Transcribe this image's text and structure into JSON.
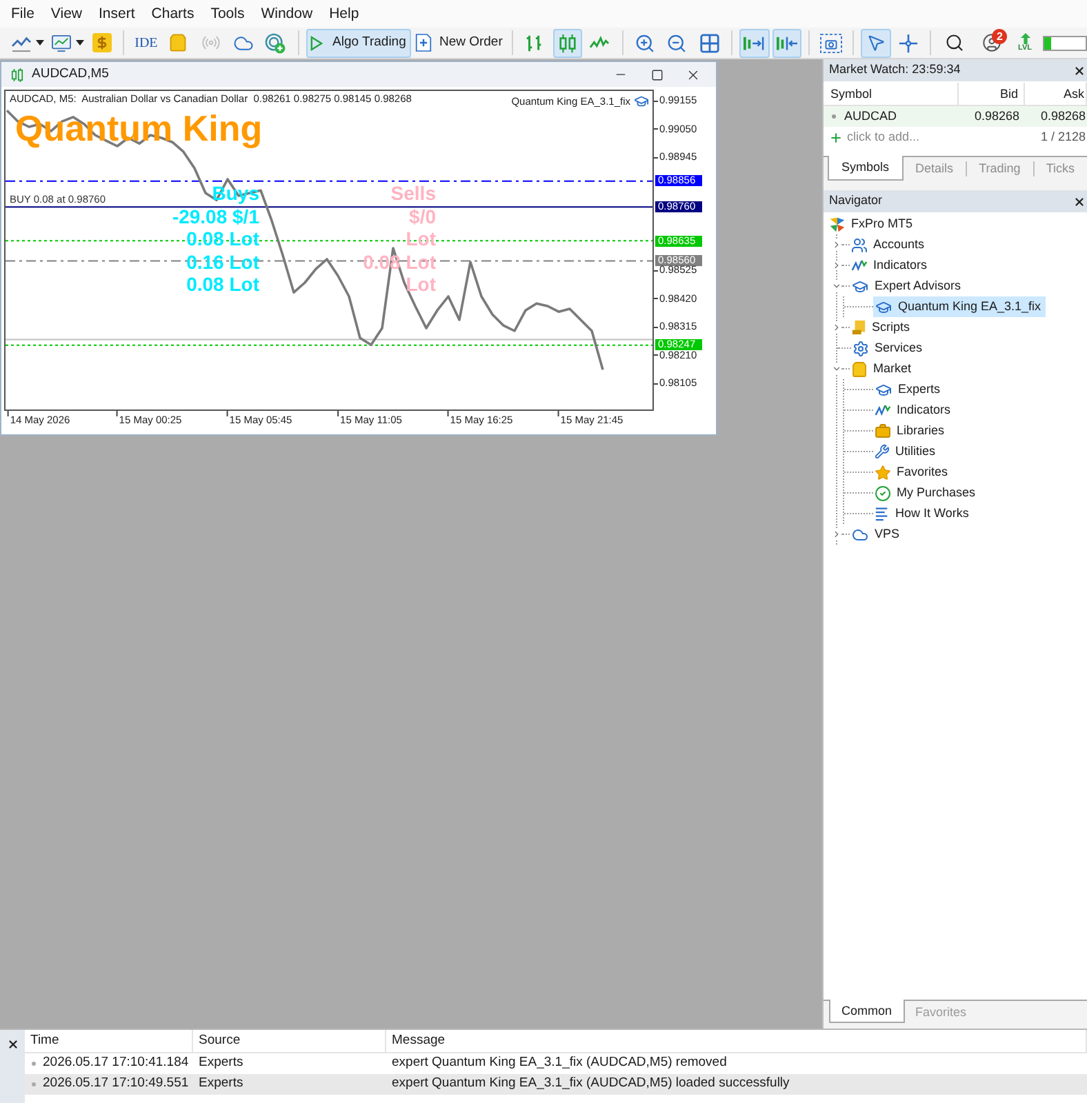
{
  "menu": [
    "File",
    "View",
    "Insert",
    "Charts",
    "Tools",
    "Window",
    "Help"
  ],
  "toolbar": {
    "ide": {
      "label": "IDE"
    },
    "algo_trading": {
      "label": "Algo Trading",
      "on": true
    },
    "new_order": {
      "label": "New Order"
    },
    "chart_types": [
      {
        "on": false
      },
      {
        "on": true
      },
      {
        "on": false
      }
    ],
    "chart_toggles": [
      {
        "on": true
      },
      {
        "on": true
      }
    ],
    "cursor_tools": [
      {
        "on": true
      },
      {
        "on": false
      }
    ],
    "notifications": {
      "count": "2"
    },
    "account_level": {
      "label": "LVL",
      "level": 0.18
    }
  },
  "chart_window": {
    "title": "AUDCAD,M5",
    "header": "AUDCAD, M5:  Australian Dollar vs Canadian Dollar  0.98261 0.98275 0.98145 0.98268",
    "expert_label": "Quantum King EA_3.1_fix",
    "overlay_title": "Quantum King",
    "buys": [
      "Buys",
      "-29.08 $/1",
      "0.08 Lot",
      "0.16 Lot",
      "0.08 Lot"
    ],
    "sells": [
      "Sells",
      "$/0",
      "Lot",
      "0.08 Lot",
      "Lot"
    ],
    "chart_data": {
      "type": "line",
      "categories": [
        null,
        null,
        null,
        "14 May 2026",
        null,
        null,
        null,
        null,
        null,
        null,
        null,
        null,
        null,
        "15 May 00:25",
        null,
        null,
        null,
        null,
        null,
        null,
        null,
        null,
        null,
        "15 May 05:45",
        null,
        null,
        null,
        null,
        null,
        null,
        null,
        null,
        null,
        "15 May 11:05",
        null,
        null,
        null,
        null,
        null,
        null,
        null,
        null,
        null,
        "15 May 16:25",
        null,
        null,
        null,
        null,
        null,
        null,
        null,
        null,
        null,
        "15 May 21:45",
        null
      ],
      "series": [
        {
          "values": [
            0.99119,
            0.99078,
            0.99058,
            0.99068,
            0.99042,
            0.99078,
            0.99094,
            0.99068,
            0.99027,
            0.99006,
            0.98986,
            0.99017,
            0.98996,
            0.99027,
            0.99017,
            0.99001,
            0.98965,
            0.98904,
            0.98812,
            0.98786,
            0.98863,
            0.98802,
            0.98812,
            0.98822,
            0.98709,
            0.98581,
            0.98443,
            0.98479,
            0.9853,
            0.98566,
            0.98505,
            0.98428,
            0.98274,
            0.98248,
            0.9831,
            0.98607,
            0.98479,
            0.98392,
            0.9831,
            0.98376,
            0.98428,
            0.98341,
            0.98556,
            0.98428,
            0.98361,
            0.9832,
            0.983,
            0.98376,
            0.98402,
            0.98392,
            0.98371,
            0.98382,
            0.98341,
            0.983,
            0.98156
          ]
        }
      ],
      "ylim": [
        0.98008,
        0.99191
      ],
      "yticks": [
        {
          "value": 0.99155,
          "label": "0.99155"
        },
        {
          "value": 0.9905,
          "label": "0.99050"
        },
        {
          "value": 0.98945,
          "label": "0.98945"
        },
        {
          "value": 0.98525,
          "label": "0.98525"
        },
        {
          "value": 0.9842,
          "label": "0.98420"
        },
        {
          "value": 0.98315,
          "label": "0.98315"
        },
        {
          "value": 0.9821,
          "label": "0.98210"
        },
        {
          "value": 0.98105,
          "label": "0.98105"
        }
      ],
      "ref_lines": [
        {
          "axis": "y",
          "value": 0.98856,
          "label": "0.98856",
          "color": "#0000ff"
        },
        {
          "axis": "y",
          "value": 0.9876,
          "label": "0.98760",
          "color": "#000080"
        },
        {
          "axis": "y",
          "value": 0.98635,
          "label": "0.98635",
          "color": "#00c800"
        },
        {
          "axis": "y",
          "value": 0.9856,
          "label": "0.98560",
          "color": "#808080"
        },
        {
          "axis": "y",
          "value": 0.98268,
          "color": "#c0c0c0"
        },
        {
          "axis": "y",
          "value": 0.98247,
          "label": "0.98247",
          "color": "#00c800"
        }
      ],
      "annotations": [
        "BUY 0.08 at 0.98760"
      ]
    }
  },
  "market_watch": {
    "title": "Market Watch: 23:59:34",
    "columns": [
      "Symbol",
      "Bid",
      "Ask"
    ],
    "rows": [
      {
        "symbol": "AUDCAD",
        "bid": "0.98268",
        "ask": "0.98268"
      }
    ],
    "add_hint": "click to add...",
    "count": "1 / 2128",
    "tabs": [
      {
        "label": "Symbols",
        "selected": true
      },
      {
        "label": "Details",
        "selected": false
      },
      {
        "label": "Trading",
        "selected": false
      },
      {
        "label": "Ticks",
        "selected": false
      }
    ]
  },
  "navigator": {
    "title": "Navigator",
    "tree": [
      {
        "label": "FxPro MT5",
        "kind": "broker",
        "selected": false,
        "children": [
          {
            "label": "Accounts",
            "kind": "accounts",
            "selected": false,
            "expanded": false
          },
          {
            "label": "Indicators",
            "kind": "indicators",
            "selected": false,
            "expanded": false
          },
          {
            "label": "Expert Advisors",
            "kind": "experts",
            "selected": false,
            "expanded": true,
            "children": [
              {
                "label": "Quantum King EA_3.1_fix",
                "kind": "experts",
                "selected": true
              }
            ]
          },
          {
            "label": "Scripts",
            "kind": "scripts",
            "selected": false,
            "expanded": false
          },
          {
            "label": "Services",
            "kind": "services",
            "selected": false
          },
          {
            "label": "Market",
            "kind": "market",
            "selected": false,
            "expanded": true,
            "children": [
              {
                "label": "Experts",
                "kind": "experts",
                "selected": false
              },
              {
                "label": "Indicators",
                "kind": "indicators",
                "selected": false
              },
              {
                "label": "Libraries",
                "kind": "libraries",
                "selected": false
              },
              {
                "label": "Utilities",
                "kind": "utilities",
                "selected": false
              },
              {
                "label": "Favorites",
                "kind": "favorites",
                "selected": false
              },
              {
                "label": "My Purchases",
                "kind": "purchases",
                "selected": false
              },
              {
                "label": "How It Works",
                "kind": "guide",
                "selected": false
              }
            ]
          },
          {
            "label": "VPS",
            "kind": "vps",
            "selected": false,
            "expanded": false
          }
        ]
      }
    ],
    "tabs": [
      {
        "label": "Common",
        "selected": true
      },
      {
        "label": "Favorites",
        "selected": false
      }
    ]
  },
  "toolbox": {
    "columns": [
      "Time",
      "Source",
      "Message"
    ],
    "rows": [
      {
        "time": "2026.05.17 17:10:41.184",
        "source": "Experts",
        "message": "expert Quantum King EA_3.1_fix (AUDCAD,M5) removed",
        "selected": false
      },
      {
        "time": "2026.05.17 17:10:49.551",
        "source": "Experts",
        "message": "expert Quantum King EA_3.1_fix (AUDCAD,M5) loaded successfully",
        "selected": true
      }
    ]
  }
}
